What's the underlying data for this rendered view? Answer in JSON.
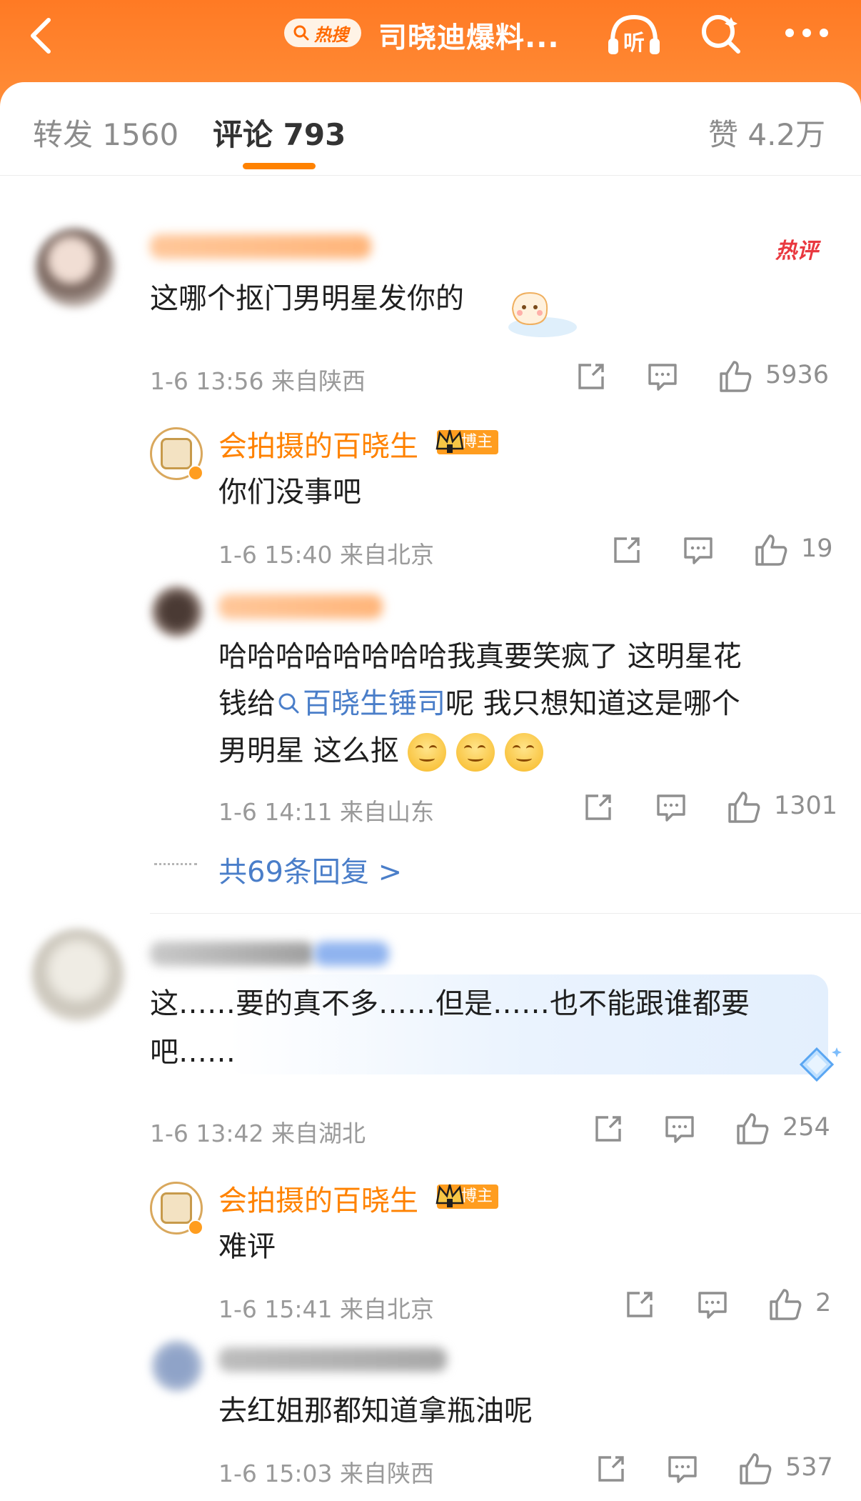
{
  "header": {
    "hot_label": "热搜",
    "title": "司晓迪爆料...",
    "listen_label": "听"
  },
  "tabs": {
    "repost": "转发 1560",
    "comments": "评论 793",
    "likes": "赞 4.2万"
  },
  "comments": [
    {
      "hot_badge": "热评",
      "text": "这哪个抠门男明星发你的",
      "meta": "1-6 13:56 来自陕西",
      "likes": "5936",
      "replies": [
        {
          "user": "会拍摄的百晓生",
          "badge": "博主",
          "text": "你们没事吧",
          "meta": "1-6 15:40 来自北京",
          "likes": "19"
        },
        {
          "text_line1": "哈哈哈哈哈哈哈哈我真要笑疯了 这明星花",
          "text_line2_prefix": "钱给",
          "text_line2_link": "百晓生锤司",
          "text_line2_suffix": "呢 我只想知道这是哪个",
          "text_line3": "男明星 这么抠",
          "meta": "1-6 14:11 来自山东",
          "likes": "1301"
        }
      ],
      "more_replies": "共69条回复 >"
    },
    {
      "text_line1": "这……要的真不多……但是……也不能跟谁都要",
      "text_line2": "吧……",
      "meta": "1-6 13:42 来自湖北",
      "likes": "254",
      "replies": [
        {
          "user": "会拍摄的百晓生",
          "badge": "博主",
          "text": "难评",
          "meta": "1-6 15:41 来自北京",
          "likes": "2"
        },
        {
          "text": "去红姐那都知道拿瓶油呢",
          "meta": "1-6 15:03 来自陕西",
          "likes": "537"
        }
      ]
    }
  ],
  "colors": {
    "header": "#ff7a24",
    "accent": "#ff8200",
    "link": "#4a7ec9",
    "hot": "#e9383f"
  }
}
